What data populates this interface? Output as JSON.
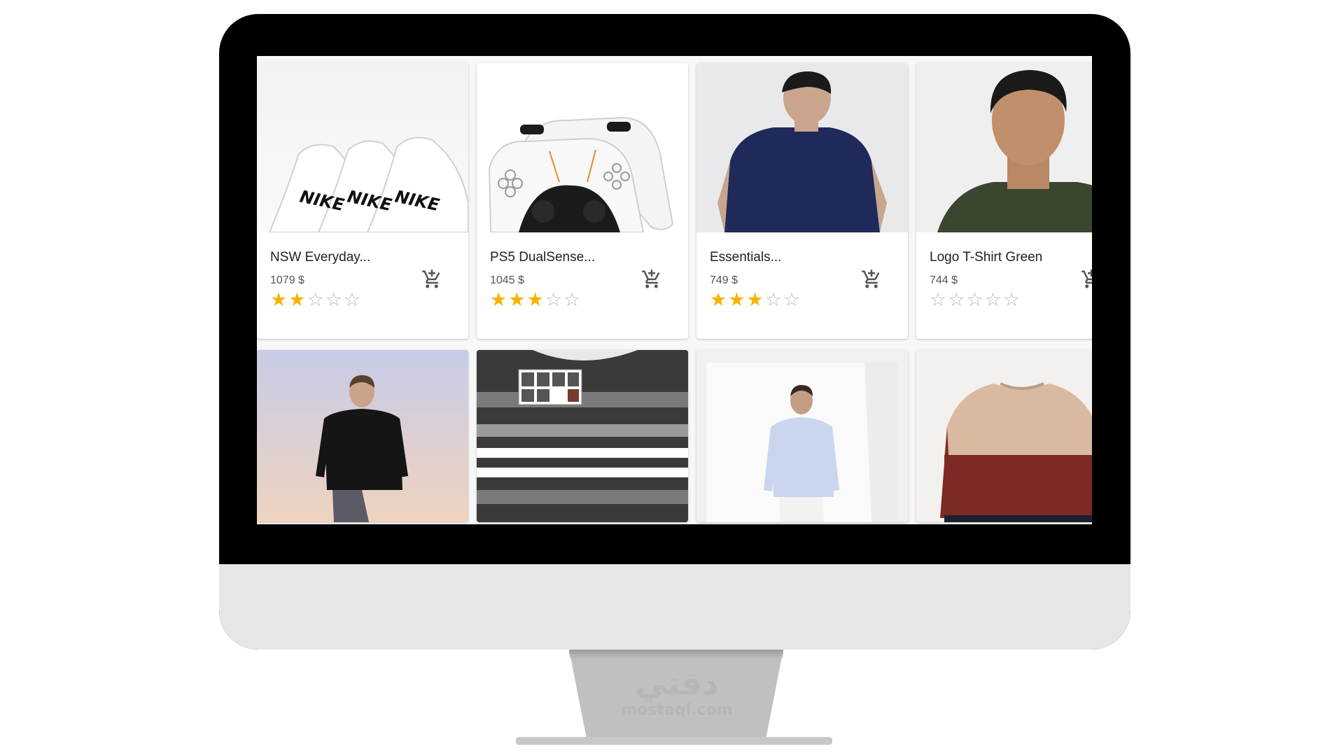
{
  "products": [
    {
      "name": "NSW Everyday...",
      "price": "1079 $",
      "rating": 2,
      "max_rating": 5,
      "image": "nike-socks",
      "cart_icon": "add-shopping-cart-icon"
    },
    {
      "name": "PS5 DualSense...",
      "price": "1045 $",
      "rating": 3,
      "max_rating": 5,
      "image": "ps5-controllers",
      "cart_icon": "add-shopping-cart-icon"
    },
    {
      "name": "Essentials...",
      "price": "749 $",
      "rating": 3,
      "max_rating": 5,
      "image": "navy-tshirt",
      "cart_icon": "add-shopping-cart-icon"
    },
    {
      "name": "Logo T-Shirt Green",
      "price": "744 $",
      "rating": 0,
      "max_rating": 5,
      "image": "green-tshirt",
      "cart_icon": "add-shopping-cart-icon"
    }
  ],
  "second_row_images": [
    "black-sweater",
    "striped-sweater",
    "white-shirt",
    "colorblock-sweater"
  ],
  "colors": {
    "star": "#f5b400",
    "star_empty": "#b9b9b9",
    "monitor_bezel": "#000000",
    "monitor_chin": "#e6e6e6"
  },
  "watermark": {
    "top": "دقتي",
    "bottom": "mostaql.com"
  }
}
